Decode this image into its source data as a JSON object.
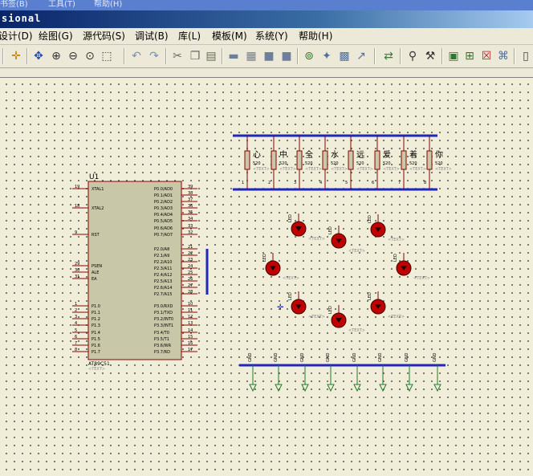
{
  "top_menu_fragment": [
    "书签(B)",
    "工具(T)",
    "帮助(H)"
  ],
  "window": {
    "title_fragment": "sional"
  },
  "menubar": {
    "items": [
      "设计(D)",
      "绘图(G)",
      "源代码(S)",
      "调试(B)",
      "库(L)",
      "模板(M)",
      "系统(Y)",
      "帮助(H)"
    ]
  },
  "toolbar": {
    "icons": [
      "origin-icon",
      "pan-icon",
      "zoom-in-icon",
      "zoom-out-icon",
      "zoom-all-icon",
      "zoom-area-icon",
      "undo-icon",
      "redo-icon",
      "cut-icon",
      "copy-icon",
      "paste-icon",
      "block-copy-icon",
      "block-move-icon",
      "block-rotate-icon",
      "block-delete-icon",
      "pick-device-icon",
      "make-device-icon",
      "package-icon",
      "decompose-icon",
      "wire-autorouter-icon",
      "search-icon",
      "property-tool-icon",
      "new-sheet-icon",
      "add-sheet-icon",
      "delete-sheet-icon",
      "netlist-icon",
      "exit-icon"
    ]
  },
  "schematic": {
    "mcu": {
      "ref": "U1",
      "part": "AT89C51",
      "text_placeholder": "<TEXT>",
      "left_pins": [
        {
          "num": "19",
          "name": "XTAL1"
        },
        {
          "num": "18",
          "name": "XTAL2"
        },
        {
          "num": "9",
          "name": "RST"
        },
        {
          "num": "29",
          "name": "PSEN"
        },
        {
          "num": "30",
          "name": "ALE"
        },
        {
          "num": "31",
          "name": "EA"
        },
        {
          "num": "1",
          "name": "P1.0"
        },
        {
          "num": "2",
          "name": "P1.1"
        },
        {
          "num": "3",
          "name": "P1.2"
        },
        {
          "num": "4",
          "name": "P1.3"
        },
        {
          "num": "5",
          "name": "P1.4"
        },
        {
          "num": "6",
          "name": "P1.5"
        },
        {
          "num": "7",
          "name": "P1.6"
        },
        {
          "num": "8",
          "name": "P1.7"
        }
      ],
      "right_pins": [
        {
          "num": "39",
          "name": "P0.0/AD0"
        },
        {
          "num": "38",
          "name": "P0.1/AD1"
        },
        {
          "num": "37",
          "name": "P0.2/AD2"
        },
        {
          "num": "36",
          "name": "P0.3/AD3"
        },
        {
          "num": "35",
          "name": "P0.4/AD4"
        },
        {
          "num": "34",
          "name": "P0.5/AD5"
        },
        {
          "num": "33",
          "name": "P0.6/AD6"
        },
        {
          "num": "32",
          "name": "P0.7/AD7"
        },
        {
          "num": "21",
          "name": "P2.0/A8"
        },
        {
          "num": "22",
          "name": "P2.1/A9"
        },
        {
          "num": "23",
          "name": "P2.2/A10"
        },
        {
          "num": "24",
          "name": "P2.3/A11"
        },
        {
          "num": "25",
          "name": "P2.4/A12"
        },
        {
          "num": "26",
          "name": "P2.5/A13"
        },
        {
          "num": "27",
          "name": "P2.6/A14"
        },
        {
          "num": "28",
          "name": "P2.7/A15"
        },
        {
          "num": "10",
          "name": "P3.0/RXD"
        },
        {
          "num": "11",
          "name": "P3.1/TXD"
        },
        {
          "num": "12",
          "name": "P3.2/INT0"
        },
        {
          "num": "13",
          "name": "P3.3/INT1"
        },
        {
          "num": "14",
          "name": "P3.4/T0"
        },
        {
          "num": "15",
          "name": "P3.5/T1"
        },
        {
          "num": "16",
          "name": "P3.6/WR"
        },
        {
          "num": "17",
          "name": "P3.7/RD"
        }
      ]
    },
    "resistors": {
      "labels": [
        "心",
        "中",
        "全",
        "水",
        "远",
        "爱",
        "着",
        "你"
      ],
      "value": "520",
      "text_placeholder": "<TEXT>",
      "pin_numbers": [
        "1",
        "2",
        "3",
        "4",
        "5",
        "6",
        "7",
        "8"
      ]
    },
    "leds": {
      "part_label": "LED",
      "text_placeholder": "<TEXT>",
      "count": 8
    },
    "ground_net": {
      "label": "GND",
      "count": 8
    }
  },
  "colors": {
    "bus": "#1f28b8",
    "component_outline": "#8b0000",
    "component_fill": "#c8c8a8",
    "led_fill": "#c00000",
    "ground_symbol": "#1e7d2e",
    "pin_label": "#000000",
    "canvas_bg": "#f0eed8"
  }
}
